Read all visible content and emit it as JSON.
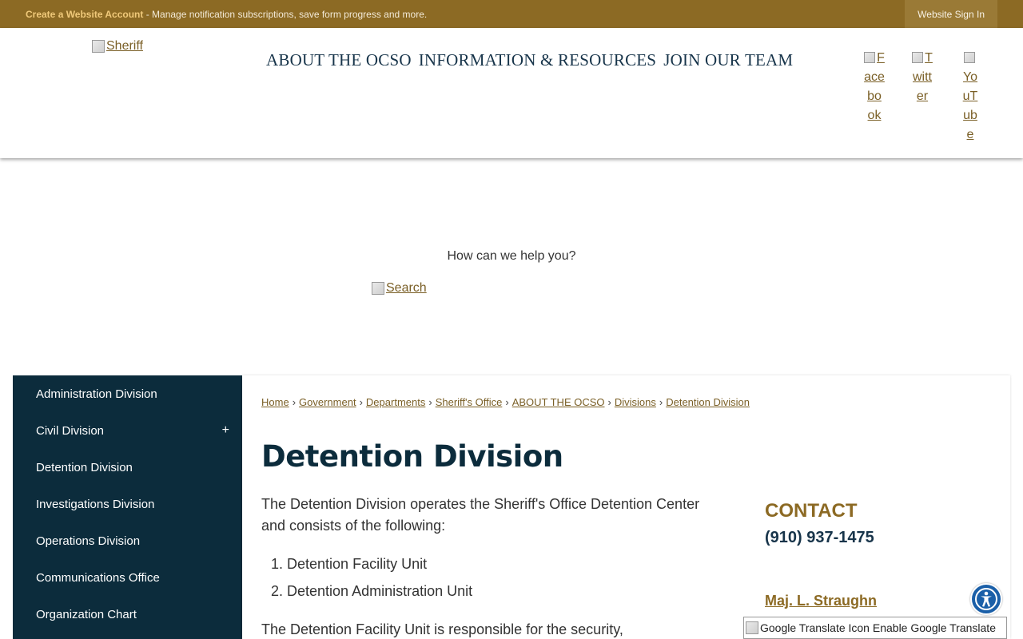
{
  "topbar": {
    "create_account_link": "Create a Website Account",
    "message": " - Manage notification subscriptions, save form progress and more.",
    "sign_in": "Website Sign In"
  },
  "header": {
    "logo_alt": "Sheriff",
    "nav": [
      "ABOUT THE OCSO",
      "INFORMATION & RESOURCES",
      "JOIN OUR TEAM"
    ],
    "social": {
      "facebook_alt": "Facebook",
      "twitter_alt": "Twitter",
      "youtube_alt": "YouTube"
    }
  },
  "search": {
    "prompt": "How can we help you?",
    "button_alt": "Search"
  },
  "sidebar": {
    "items": [
      {
        "label": "Administration Division",
        "expand": ""
      },
      {
        "label": "Civil Division",
        "expand": "+"
      },
      {
        "label": "Detention Division",
        "expand": ""
      },
      {
        "label": "Investigations Division",
        "expand": ""
      },
      {
        "label": "Operations Division",
        "expand": ""
      },
      {
        "label": "Communications Office",
        "expand": ""
      },
      {
        "label": "Organization Chart",
        "expand": ""
      }
    ]
  },
  "breadcrumb": [
    "Home",
    "Government",
    "Departments",
    "Sheriff's Office",
    "ABOUT THE OCSO",
    "Divisions",
    "Detention Division"
  ],
  "breadcrumb_separator": "›",
  "page": {
    "title": "Detention Division",
    "intro": "The Detention Division operates the Sheriff's Office Detention Center and consists of the following:",
    "units": [
      "1. Detention Facility Unit",
      "2. Detention Administration Unit"
    ],
    "more": "The Detention Facility Unit is responsible for the security,"
  },
  "contact": {
    "heading": "CONTACT",
    "phone": "(910) 937-1475",
    "person": "Maj. L. Straughn"
  },
  "translate": {
    "icon_alt": "Google Translate Icon",
    "label": "Enable Google Translate"
  },
  "colors": {
    "topbar": "#8c6a24",
    "sidebar": "#0c2c3c",
    "accent": "#8c6a24",
    "title": "#0c2c3c"
  }
}
